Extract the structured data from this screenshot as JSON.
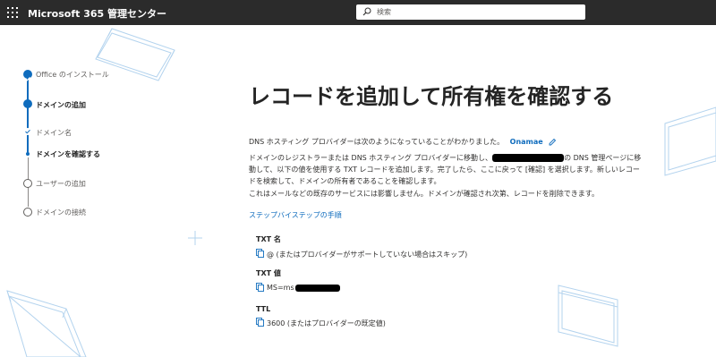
{
  "header": {
    "app_title": "Microsoft 365 管理センター",
    "search_placeholder": "検索"
  },
  "steps": [
    {
      "label": "Office のインストール",
      "state": "completed"
    },
    {
      "label": "ドメインの追加",
      "state": "current"
    },
    {
      "label": "ドメイン名",
      "state": "sub-completed"
    },
    {
      "label": "ドメインを確認する",
      "state": "sub-current"
    },
    {
      "label": "ユーザーの追加",
      "state": "pending"
    },
    {
      "label": "ドメインの接続",
      "state": "pending"
    }
  ],
  "main": {
    "title": "レコードを追加して所有権を確認する",
    "provider_text": "DNS ホスティング プロバイダーは次のようになっていることがわかりました。",
    "provider_name": "Onamae",
    "instructions_part1": "ドメインのレジストラーまたは DNS ホスティング プロバイダーに移動し、",
    "instructions_part2": "の DNS 管理ページに移動して、以下の値を使用する TXT レコードを追加します。完了したら、ここに戻って [確認] を選択します。新しいレコードを検索して、ドメインの所有者であることを確認します。",
    "note": "これはメールなどの既存のサービスには影響しません。ドメインが確認され次第、レコードを削除できます。",
    "step_by_step_link": "ステップバイステップの手順"
  },
  "records": [
    {
      "label": "TXT 名",
      "value": "@ (またはプロバイダーがサポートしていない場合はスキップ)"
    },
    {
      "label": "TXT 値",
      "value": "MS=ms"
    },
    {
      "label": "TTL",
      "value": "3600 (またはプロバイダーの既定値)"
    }
  ],
  "colors": {
    "accent": "#0f6cbd",
    "topbar": "#2b2b2b"
  }
}
